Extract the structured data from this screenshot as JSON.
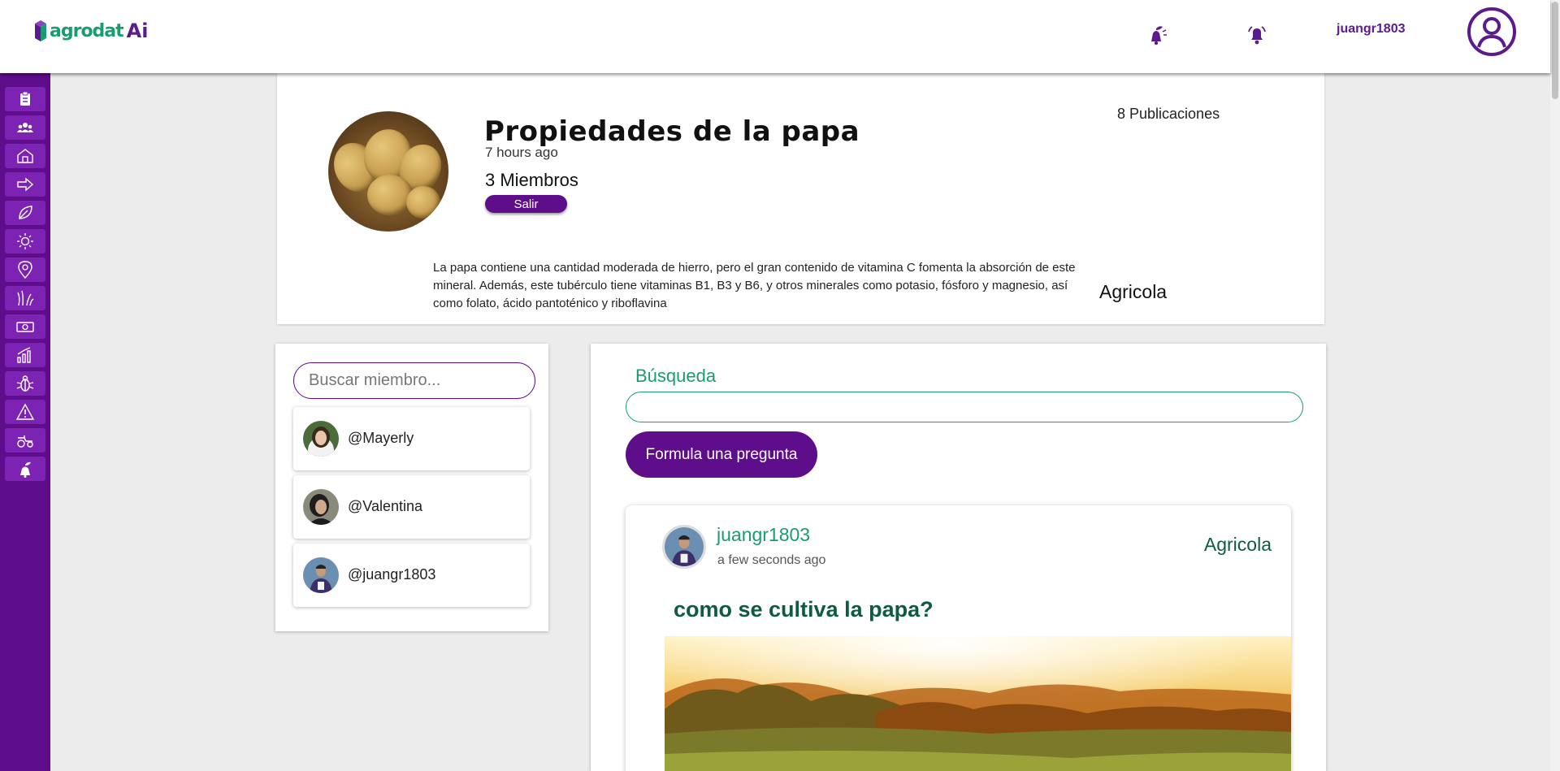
{
  "brand": {
    "logo_text": "agrodat",
    "logo_ai": "Ai"
  },
  "topbar": {
    "icons": [
      "plant-bell-icon",
      "bell-icon"
    ],
    "username": "juangr1803",
    "avatar_icon": "user-circle-icon"
  },
  "sidebar": {
    "items": [
      {
        "icon": "clipboard-icon"
      },
      {
        "icon": "group-icon"
      },
      {
        "icon": "barn-icon"
      },
      {
        "icon": "arrow-right-icon"
      },
      {
        "icon": "leaf-icon"
      },
      {
        "icon": "sun-icon"
      },
      {
        "icon": "location-pin-icon"
      },
      {
        "icon": "crop-icon"
      },
      {
        "icon": "money-icon"
      },
      {
        "icon": "bar-chart-icon"
      },
      {
        "icon": "bug-icon"
      },
      {
        "icon": "warning-icon"
      },
      {
        "icon": "tractor-icon"
      },
      {
        "icon": "plant-hand-icon"
      }
    ]
  },
  "group": {
    "title": "Propiedades de la papa",
    "time": "7 hours ago",
    "members": "3 Miembros",
    "leave_label": "Salir",
    "publications": "8 Publicaciones",
    "description": "La papa contiene una cantidad moderada de hierro, pero el gran contenido de vitamina C fomenta la absorción de este mineral. Además, este tubérculo tiene vitaminas B1, B3 y B6, y otros minerales como potasio, fósforo y magnesio, así como folato, ácido pantoténico y riboflavina",
    "category": "Agricola"
  },
  "members_panel": {
    "search_placeholder": "Buscar miembro...",
    "members": [
      {
        "name": "@Mayerly"
      },
      {
        "name": "@Valentina"
      },
      {
        "name": "@juangr1803"
      }
    ]
  },
  "feed": {
    "search_label": "Búsqueda",
    "search_value": "",
    "ask_label": "Formula una pregunta",
    "posts": [
      {
        "user": "juangr1803",
        "time": "a few seconds ago",
        "category": "Agricola",
        "title": "como se cultiva la papa?"
      }
    ]
  },
  "colors": {
    "primary": "#5e0d8b",
    "accent": "#1a9d6e",
    "dark_green": "#0e5c40"
  }
}
